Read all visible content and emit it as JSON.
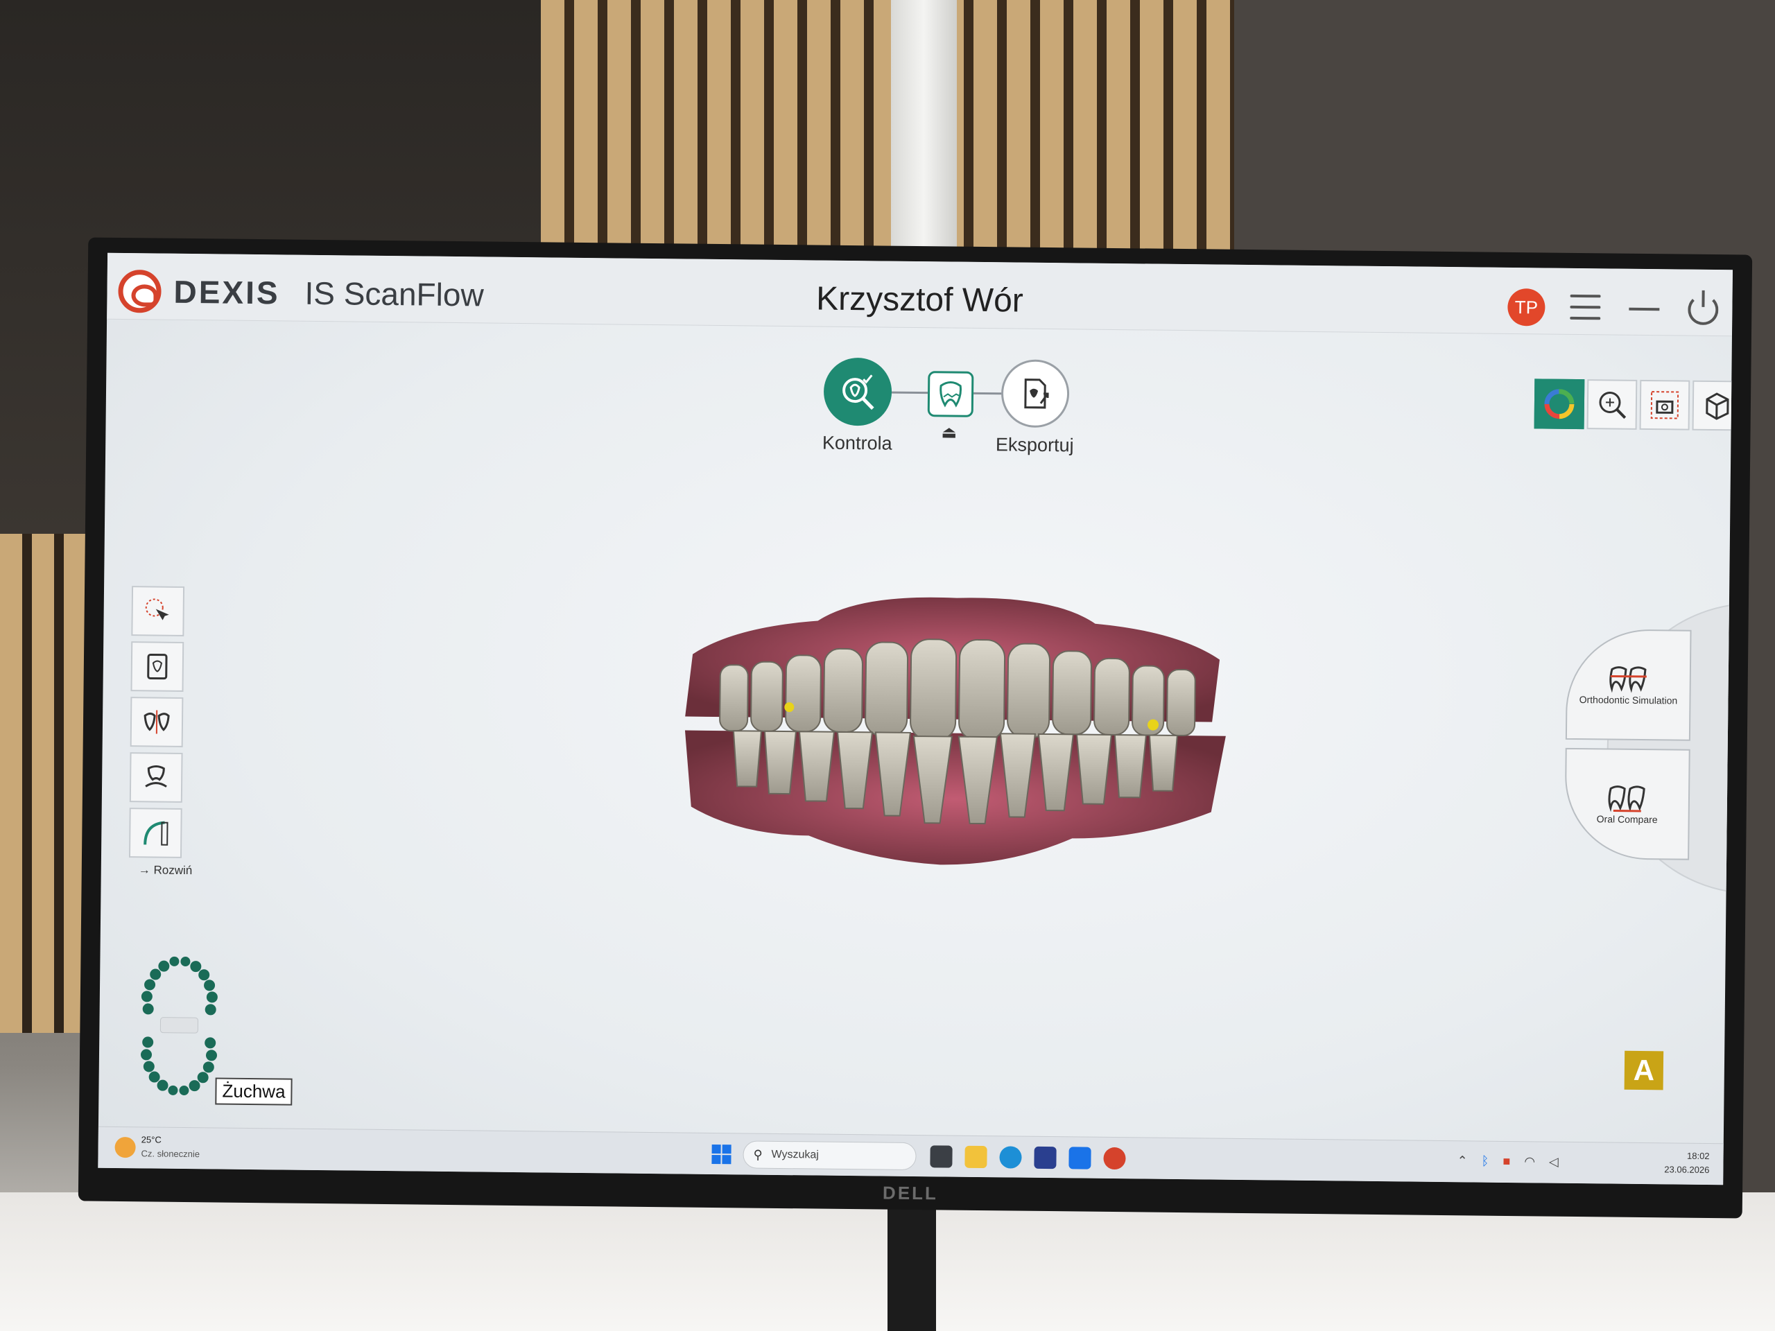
{
  "app": {
    "brand": "DEXIS",
    "product": "IS ScanFlow",
    "patient_name": "Krzysztof Wór",
    "user_initials": "TP"
  },
  "workflow": {
    "steps": [
      {
        "label": "Kontrola",
        "icon": "tooth-check-icon",
        "state": "active"
      },
      {
        "label": "",
        "icon": "tooth-icon",
        "state": "current"
      },
      {
        "label": "Eksportuj",
        "icon": "export-icon",
        "state": "inactive"
      }
    ],
    "home_glyph": "⏏"
  },
  "toolbar_right": {
    "items": [
      "color-wheel-icon",
      "zoom-fit-icon",
      "screenshot-icon",
      "wireframe-cube-icon",
      "chevron-right-icon"
    ],
    "chevron": "›"
  },
  "toolbar_left": {
    "items": [
      "lasso-select-icon",
      "tooth-file-icon",
      "tooth-pair-icon",
      "bite-icon",
      "ruler-curve-icon"
    ],
    "expand_label": "→ Rozwiń"
  },
  "radial_menu": {
    "items": [
      {
        "label": "Orthodontic Simulation",
        "icon": "braces-icon"
      },
      {
        "label": "Oral Compare",
        "icon": "teeth-compare-icon"
      }
    ]
  },
  "arch": {
    "jaw_label": "Żuchwa"
  },
  "badge": {
    "label": "A",
    "color": "#c9a416"
  },
  "taskbar": {
    "weather_temp": "25°C",
    "weather_desc": "Cz. słonecznie",
    "search_placeholder": "Wyszukaj",
    "time": "18:02",
    "date": "23.06.2026"
  },
  "bezel": {
    "logo": "DELL"
  },
  "colors": {
    "accent": "#1f8a72",
    "brand_red": "#d5432c"
  }
}
